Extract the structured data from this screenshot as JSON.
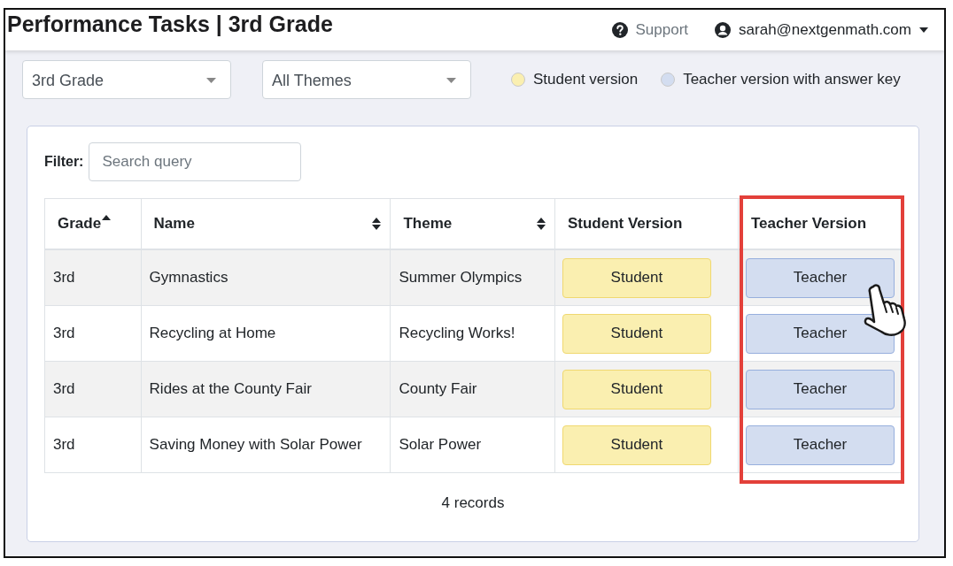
{
  "header": {
    "title": "Performance Tasks | 3rd Grade",
    "support": "Support",
    "user": "sarah@nextgenmath.com"
  },
  "filters": {
    "grade": "3rd Grade",
    "theme": "All Themes"
  },
  "legend": [
    {
      "label": "Student version",
      "color": "#faefb0"
    },
    {
      "label": "Teacher version with answer key",
      "color": "#d3ddf0"
    }
  ],
  "search": {
    "label": "Filter:",
    "placeholder": "Search query"
  },
  "table": {
    "columns": [
      {
        "label": "Grade",
        "sortable": true,
        "sorted": true
      },
      {
        "label": "Name",
        "sortable": true,
        "sorted": false
      },
      {
        "label": "Theme",
        "sortable": true,
        "sorted": false
      },
      {
        "label": "Student Version",
        "sortable": false,
        "sorted": false
      },
      {
        "label": "Teacher Version",
        "sortable": false,
        "sorted": false,
        "highlighted": true
      }
    ],
    "rows": [
      {
        "grade": "3rd",
        "name": "Gymnastics",
        "theme": "Summer Olympics",
        "student": "Student",
        "teacher": "Teacher"
      },
      {
        "grade": "3rd",
        "name": "Recycling at Home",
        "theme": "Recycling Works!",
        "student": "Student",
        "teacher": "Teacher"
      },
      {
        "grade": "3rd",
        "name": "Rides at the County Fair",
        "theme": "County Fair",
        "student": "Student",
        "teacher": "Teacher"
      },
      {
        "grade": "3rd",
        "name": "Saving Money with Solar Power",
        "theme": "Solar Power",
        "student": "Student",
        "teacher": "Teacher"
      }
    ],
    "footer": "4 records"
  }
}
